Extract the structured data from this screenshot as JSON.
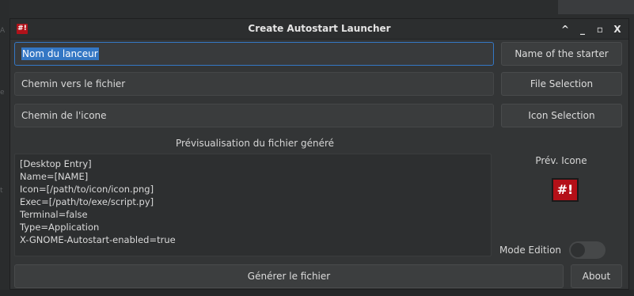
{
  "window": {
    "title": "Create Autostart Launcher",
    "app_icon_text": "#!",
    "controls": {
      "maximize": "^",
      "minimize": "_",
      "restore": "▫",
      "close": "X"
    }
  },
  "desktop": {
    "glyphs": [
      "A",
      "e",
      "t"
    ]
  },
  "form": {
    "name_value": "Nom du lanceur",
    "name_button": "Name of the starter",
    "path_value": "Chemin vers le fichier",
    "path_button": "File Selection",
    "icon_value": "Chemin de l'icone",
    "icon_button": "Icon Selection"
  },
  "preview": {
    "label": "Prévisualisation du fichier généré",
    "content": "[Desktop Entry]\nName=[NAME]\nIcon=[/path/to/icon/icon.png]\nExec=[/path/to/exe/script.py]\nTerminal=false\nType=Application\nX-GNOME-Autostart-enabled=true"
  },
  "icon_preview": {
    "label": "Prév. Icone",
    "glyph": "#!"
  },
  "mode_edition": {
    "label": "Mode Edition",
    "enabled": false
  },
  "footer": {
    "generate_button": "Générer le fichier",
    "about_button": "About"
  },
  "colors": {
    "accent": "#3477c4",
    "icon_red": "#b41018"
  }
}
